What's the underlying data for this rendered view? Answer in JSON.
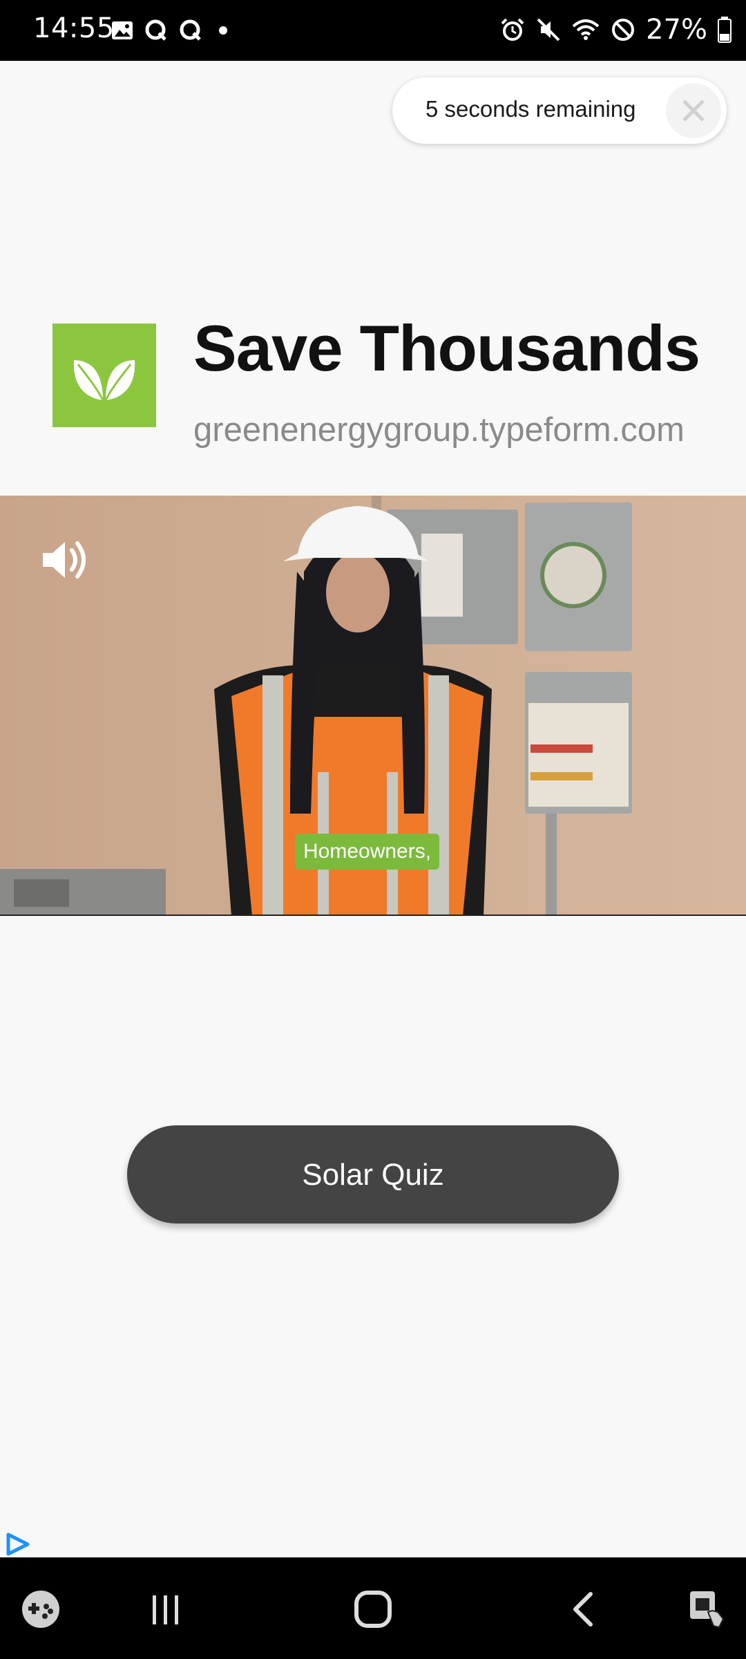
{
  "status_bar": {
    "time": "14:55",
    "battery": "27%",
    "left_icons": [
      "image-icon",
      "q-icon",
      "q-icon",
      "dot-icon"
    ],
    "right_icons": [
      "alarm-icon",
      "mute-icon",
      "wifi-icon",
      "dnd-icon",
      "battery-icon"
    ]
  },
  "countdown": {
    "text": "5 seconds remaining"
  },
  "ad": {
    "title": "Save Thousands",
    "url": "greenenergygroup.typeform.com",
    "brand_color": "#8cc63f"
  },
  "video": {
    "caption": "Homeowners,",
    "sound_icon": "speaker-icon"
  },
  "cta": {
    "label": "Solar Quiz"
  },
  "nav": {
    "buttons": [
      "game-launcher",
      "recents",
      "home",
      "back",
      "assistant"
    ]
  }
}
